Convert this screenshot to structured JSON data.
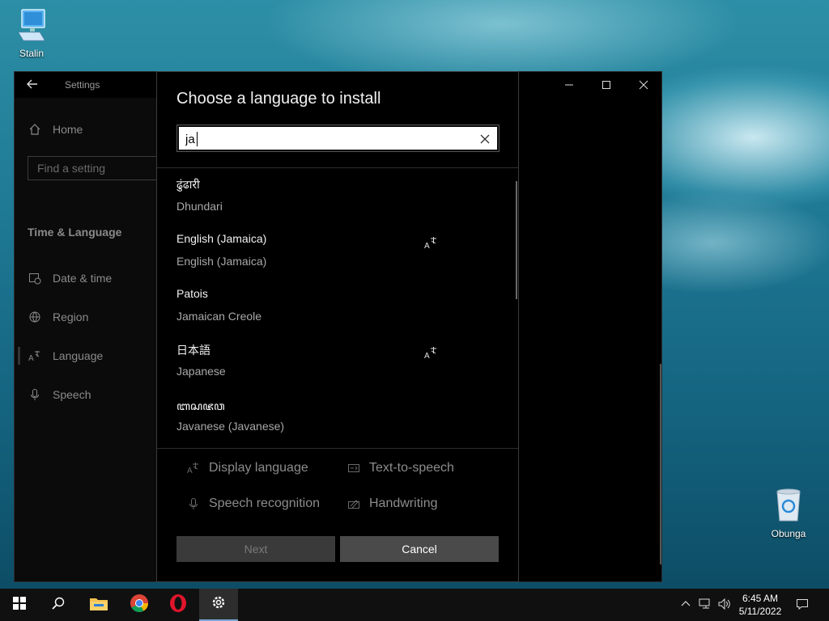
{
  "desktop": {
    "icons": [
      {
        "label": "Stalin",
        "icon": "computer-icon"
      },
      {
        "label": "Obunga",
        "icon": "recycle-bin-icon"
      }
    ]
  },
  "settings": {
    "title": "Settings",
    "nav": {
      "home": "Home",
      "search_placeholder": "Find a setting",
      "section": "Time & Language",
      "items": [
        {
          "label": "Date & time",
          "icon": "calendar-clock-icon"
        },
        {
          "label": "Region",
          "icon": "globe-icon"
        },
        {
          "label": "Language",
          "icon": "language-icon"
        },
        {
          "label": "Speech",
          "icon": "microphone-icon"
        }
      ]
    }
  },
  "dialog": {
    "title": "Choose a language to install",
    "search_value": "ja",
    "languages": [
      {
        "native": "ढुंढारी",
        "english": "Dhundari",
        "display_language": false
      },
      {
        "native": "English (Jamaica)",
        "english": "English (Jamaica)",
        "display_language": true
      },
      {
        "native": "Patois",
        "english": "Jamaican Creole",
        "display_language": false
      },
      {
        "native": "日本語",
        "english": "Japanese",
        "display_language": true
      },
      {
        "native": "ꦧꦱꦗꦮ",
        "english": "Javanese (Javanese)",
        "display_language": false
      }
    ],
    "features": {
      "display_language": "Display language",
      "tts": "Text-to-speech",
      "speech_recognition": "Speech recognition",
      "handwriting": "Handwriting"
    },
    "buttons": {
      "next": "Next",
      "cancel": "Cancel"
    }
  },
  "taskbar": {
    "apps": [
      "start-icon",
      "search-icon",
      "file-explorer-icon",
      "chrome-icon",
      "opera-icon",
      "settings-icon"
    ],
    "clock": {
      "time": "6:45 AM",
      "date": "5/11/2022"
    }
  },
  "colors": {
    "accent": "#7aa7d6",
    "dialog_bg": "#000000",
    "wallpaper": "#1f7a95"
  }
}
